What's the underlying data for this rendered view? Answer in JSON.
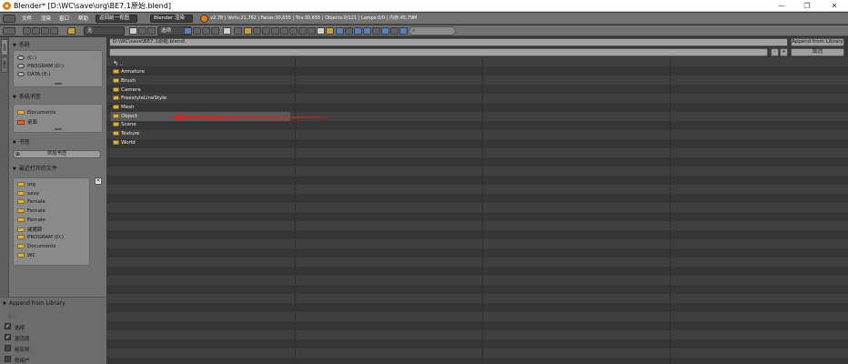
{
  "window": {
    "title": "Blender* [D:\\WC\\save\\org\\BE7.1原始.blend]",
    "minimize": "—",
    "restore": "❐",
    "close": "✕"
  },
  "info_header": {
    "menu": [
      "文件",
      "渲染",
      "窗口",
      "帮助"
    ],
    "back_button": "返回前一视图",
    "engine": "Blender 渲染",
    "stats": "v2.78 | Verts:21,762 | Faces:30,655 | Tris:30,655 | Objects:0/121 | Lamps:0/0 | 内存:45.79M"
  },
  "fb_header": {
    "display_select": "无",
    "filter_select": "选项"
  },
  "sidebar": {
    "tabs": [
      "系统",
      "最近"
    ],
    "system": {
      "heading": "系统",
      "items": [
        "(C:)",
        "PROGRAM (D:)",
        "DATA (E:)"
      ]
    },
    "system_bookmarks": {
      "heading": "系统书签",
      "items": [
        "Documents",
        "桌面"
      ]
    },
    "bookmarks": {
      "heading": "书签",
      "add_label": "添加书签"
    },
    "recent": {
      "heading": "最近打开的文件",
      "clear": "✕",
      "items": [
        "org",
        "save",
        "Female",
        "Female",
        "Female",
        "咸猪蹄",
        "PROGRAM (D:)",
        "Documents",
        "WC"
      ]
    },
    "append": {
      "heading": "Append from Library",
      "sub": "导入",
      "options": [
        {
          "label": "选择",
          "checked": true
        },
        {
          "label": "激活层",
          "checked": true
        },
        {
          "label": "组实例",
          "checked": false
        },
        {
          "label": "伪用户",
          "checked": false
        }
      ]
    }
  },
  "main": {
    "directory": "D:\\WC\\save\\BE7.1原始.blend\\",
    "filename": "",
    "append_button": "Append from Library",
    "cancel_button": "取消",
    "parent_dir": "..",
    "folders": [
      "Armature",
      "Brush",
      "Camera",
      "FreestyleLineStyle",
      "Mesh",
      "Object",
      "Scene",
      "Texture",
      "World"
    ],
    "selected_folder": "Object",
    "arrow_color": "#e02020"
  }
}
